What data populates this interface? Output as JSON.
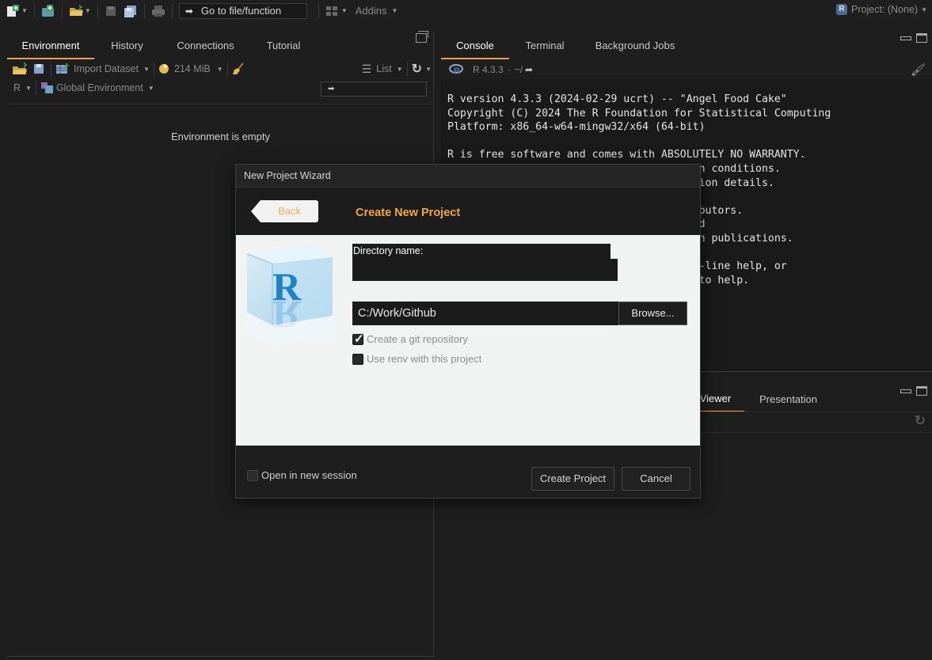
{
  "toolbar": {
    "goto_label": "Go to file/function",
    "addins_label": "Addins",
    "project_label": "Project: (None)",
    "project_badge": "R"
  },
  "left_pane": {
    "tabs": [
      "Environment",
      "History",
      "Connections",
      "Tutorial"
    ],
    "active_tab": "Environment",
    "import_dataset": "Import Dataset",
    "memory": "214 MiB",
    "view_mode": "List",
    "language": "R",
    "scope": "Global Environment",
    "search_value": "➡",
    "empty_message": "Environment is empty"
  },
  "console_pane": {
    "tabs": [
      "Console",
      "Terminal",
      "Background Jobs"
    ],
    "active_tab": "Console",
    "r_version_badge": "R 4.3.3",
    "working_dir": "~/",
    "lines": [
      "R version 4.3.3 (2024-02-29 ucrt) -- \"Angel Food Cake\"",
      "Copyright (C) 2024 The R Foundation for Statistical Computing",
      "Platform: x86_64-w64-mingw32/x64 (64-bit)",
      "",
      "R is free software and comes with ABSOLUTELY NO WARRANTY.",
      "                                  certain conditions.",
      "                                  tribution details.",
      "",
      "                                  contributors.",
      "                                  ion and",
      "                                  nges in publications.",
      "",
      "                                  for on-line help, or",
      "                                  rface to help."
    ]
  },
  "bottom_right_pane": {
    "tabs": [
      "Viewer",
      "Presentation"
    ],
    "active_tab": "Viewer"
  },
  "dialog": {
    "window_title": "New Project Wizard",
    "back_label": "Back",
    "heading": "Create New Project",
    "directory_name_label": "Directory name:",
    "directory_name_value": "",
    "parent_path": "C:/Work/Github",
    "browse_label": "Browse...",
    "git_label": "Create a git repository",
    "git_checked": true,
    "renv_label": "Use renv with this project",
    "renv_checked": false,
    "open_new_session_label": "Open in new session",
    "create_label": "Create Project",
    "cancel_label": "Cancel"
  },
  "colors": {
    "accent": "#e8a14a",
    "heading": "#f2a83a",
    "background": "#1e1e1e",
    "dialog_content": "#f1f2f2"
  }
}
